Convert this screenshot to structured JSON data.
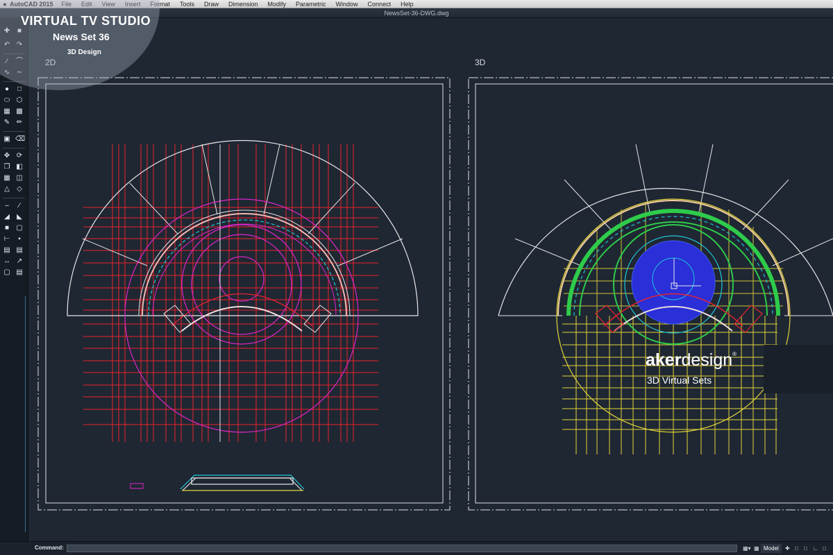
{
  "menubar": {
    "app_name": "AutoCAD 2015",
    "items": [
      "File",
      "Edit",
      "View",
      "Insert",
      "Format",
      "Tools",
      "Draw",
      "Dimension",
      "Modify",
      "Parametric",
      "Window",
      "Connect",
      "Help"
    ]
  },
  "window": {
    "title": "NewsSet-36-DWG.dwg"
  },
  "viewports": {
    "left_label": "2D",
    "right_label": "3D"
  },
  "overlay": {
    "title": "VIRTUAL TV STUDIO",
    "subtitle": "News Set 36",
    "subtitle2": "3D Design"
  },
  "brand": {
    "part1": "aker",
    "part2": "design",
    "mark": "®",
    "tagline": "3D Virtual Sets"
  },
  "command": {
    "label": "Command:",
    "value": ""
  },
  "status": {
    "model": "Model"
  },
  "colors": {
    "background": "#1f2733",
    "red": "#e8232e",
    "magenta": "#e025c9",
    "yellow": "#e3d63a",
    "green": "#2ecc4a",
    "blue": "#2a2fd8",
    "cyan": "#1fc7d8",
    "white": "#e8e8e8"
  },
  "toolbar_icons": [
    "select-icon",
    "move-icon",
    "undo-icon",
    "redo-icon",
    "line-icon",
    "arc-icon",
    "circle-icon",
    "rectangle-icon",
    "polygon-icon",
    "hatch-icon",
    "erase-icon",
    "copy-icon",
    "rotate-icon",
    "scale-icon",
    "mirror-icon",
    "offset-icon",
    "trim-icon",
    "extend-icon",
    "fillet-icon",
    "chamfer-icon",
    "array-icon",
    "text-icon",
    "dimension-icon",
    "layer-icon"
  ]
}
